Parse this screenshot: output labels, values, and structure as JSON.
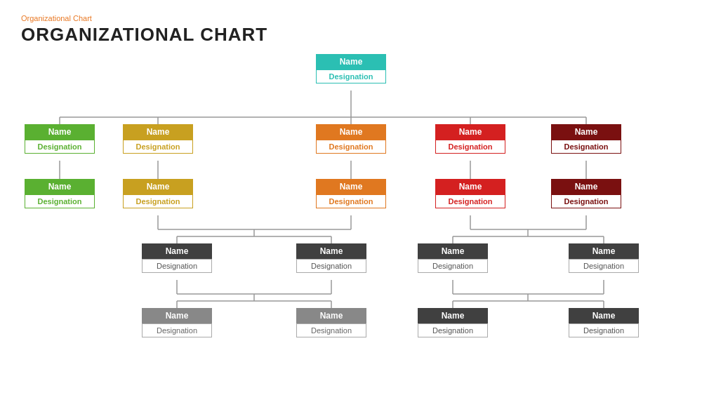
{
  "header": {
    "subtitle": "Organizational  Chart",
    "title": "ORGANIZATIONAL CHART"
  },
  "nodes": {
    "root": {
      "name": "Name",
      "designation": "Designation"
    },
    "l1_green1": {
      "name": "Name",
      "designation": "Designation"
    },
    "l1_gold1": {
      "name": "Name",
      "designation": "Designation"
    },
    "l1_orange1": {
      "name": "Name",
      "designation": "Designation"
    },
    "l1_red1": {
      "name": "Name",
      "designation": "Designation"
    },
    "l1_darkred1": {
      "name": "Name",
      "designation": "Designation"
    },
    "l2_green1": {
      "name": "Name",
      "designation": "Designation"
    },
    "l2_gold1": {
      "name": "Name",
      "designation": "Designation"
    },
    "l2_orange1": {
      "name": "Name",
      "designation": "Designation"
    },
    "l2_red1": {
      "name": "Name",
      "designation": "Designation"
    },
    "l2_darkred1": {
      "name": "Name",
      "designation": "Designation"
    },
    "l3_dg1": {
      "name": "Name",
      "designation": "Designation"
    },
    "l3_dg2": {
      "name": "Name",
      "designation": "Designation"
    },
    "l3_dg3": {
      "name": "Name",
      "designation": "Designation"
    },
    "l3_dg4": {
      "name": "Name",
      "designation": "Designation"
    },
    "l4_lg1": {
      "name": "Name",
      "designation": "Designation"
    },
    "l4_lg2": {
      "name": "Name",
      "designation": "Designation"
    },
    "l4_lg3": {
      "name": "Name",
      "designation": "Designation"
    },
    "l4_lg4": {
      "name": "Name",
      "designation": "Designation"
    }
  }
}
